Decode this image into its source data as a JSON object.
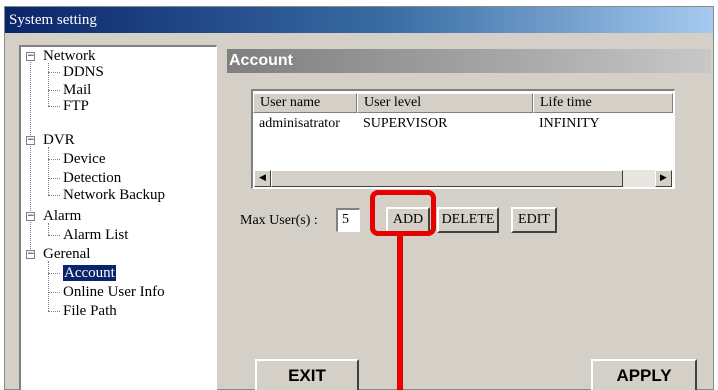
{
  "window": {
    "title": "System setting"
  },
  "tree": {
    "groups": [
      {
        "label": "Network",
        "expander": "−",
        "children": [
          "DDNS",
          "Mail",
          "FTP"
        ]
      },
      {
        "label": "DVR",
        "expander": "−",
        "children": [
          "Device",
          "Detection",
          "Network Backup"
        ]
      },
      {
        "label": "Alarm",
        "expander": "−",
        "children": [
          "Alarm List"
        ]
      },
      {
        "label": "Gerenal",
        "expander": "−",
        "children": [
          "Account",
          "Online User Info",
          "File Path"
        ]
      }
    ],
    "selected": "Account"
  },
  "panel": {
    "title": "Account"
  },
  "table": {
    "columns": [
      "User name",
      "User level",
      "Life time"
    ],
    "rows": [
      [
        "adminisatrator",
        "SUPERVISOR",
        "INFINITY"
      ]
    ],
    "scroll_left_icon": "◀",
    "scroll_right_icon": "▶"
  },
  "max_users": {
    "label": "Max User(s) :",
    "value": "5"
  },
  "buttons": {
    "add": "ADD",
    "delete": "DELETE",
    "edit": "EDIT",
    "exit": "EXIT",
    "apply": "APPLY"
  },
  "colors": {
    "highlight": "#e60000",
    "titlebar": "#0a246a",
    "selection": "#0a246a"
  }
}
